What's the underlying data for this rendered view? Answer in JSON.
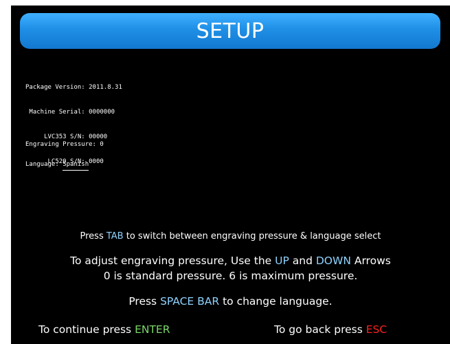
{
  "header": {
    "title": "SETUP"
  },
  "info": [
    "Package Version: 2011.8.31",
    " Machine Serial: 0000000",
    "     LVC353 S/N: 00000",
    "      LC520 S/N: 0000"
  ],
  "engraving": {
    "label": "Engraving Pressure:",
    "value": "0"
  },
  "language": {
    "label": "Language:",
    "value": "Spanish"
  },
  "instructions": {
    "tab_line": {
      "pre": "Press ",
      "key": "TAB",
      "post": " to switch between engraving pressure & language select"
    },
    "adjust_line": {
      "pre": "To adjust  engraving pressure, Use the ",
      "key_up": "UP",
      "mid": " and ",
      "key_down": "DOWN",
      "post": " Arrows"
    },
    "pressure_line": "0 is standard pressure. 6 is maximum pressure.",
    "space_line": {
      "pre": "Press ",
      "key": "SPACE BAR",
      "post": " to change language."
    }
  },
  "footer": {
    "continue": {
      "pre": "To continue press ",
      "key": "ENTER"
    },
    "back": {
      "pre": "To go back press ",
      "key": "ESC"
    }
  },
  "colors": {
    "header": "#1f8fe6",
    "key_blue": "#8fd3ff",
    "key_green": "#7cd86a",
    "key_red": "#ff2020",
    "background": "#000000"
  }
}
